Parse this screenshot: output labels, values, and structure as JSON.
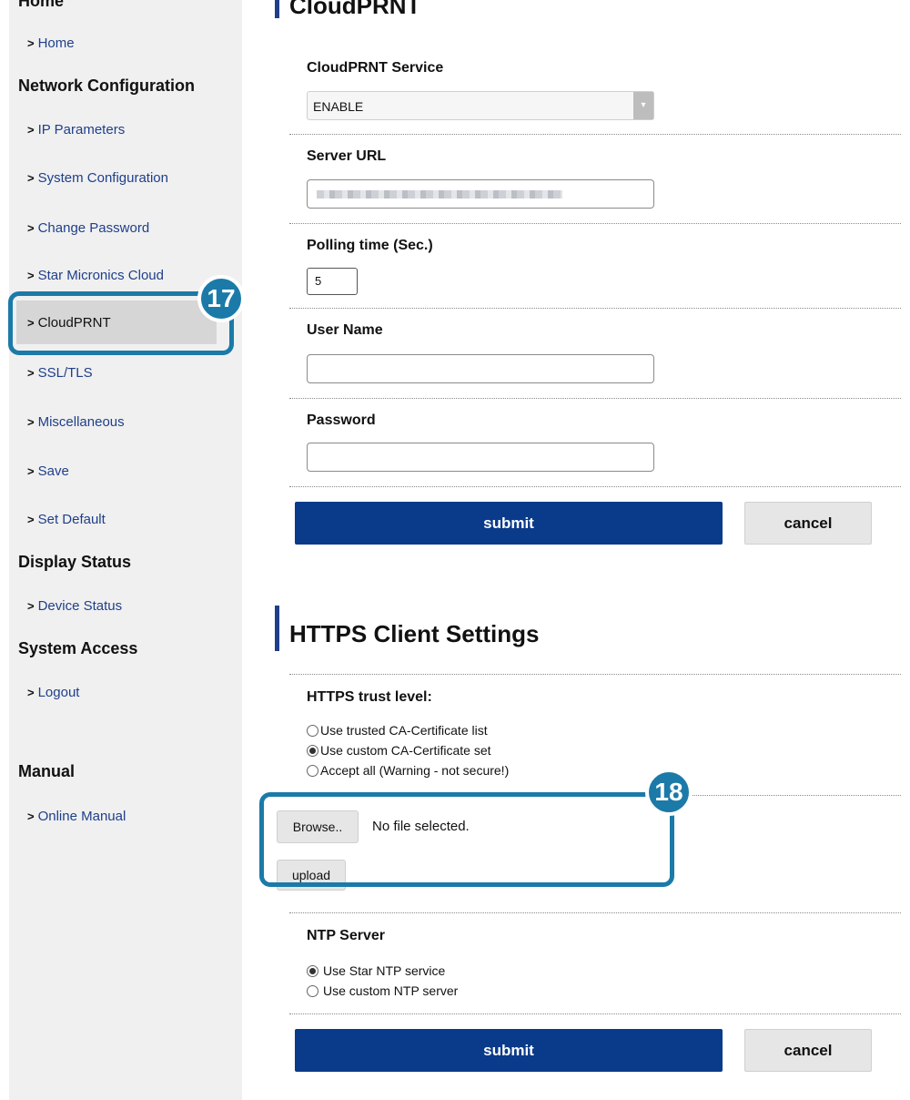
{
  "sidebar": {
    "headings": {
      "home": "Home",
      "network": "Network Configuration",
      "display": "Display Status",
      "access": "System Access",
      "manual": "Manual"
    },
    "items": {
      "home": "Home",
      "ip": "IP Parameters",
      "system": "System Configuration",
      "password": "Change Password",
      "cloud": "Star Micronics Cloud",
      "cloudprnt": "CloudPRNT",
      "ssl": "SSL/TLS",
      "misc": "Miscellaneous",
      "save": "Save",
      "default": "Set Default",
      "device": "Device Status",
      "logout": "Logout",
      "online": "Online Manual"
    },
    "chevron": ">"
  },
  "callouts": {
    "c17": "17",
    "c18": "18"
  },
  "cloudprnt": {
    "title": "CloudPRNT",
    "service_label": "CloudPRNT Service",
    "service_value": "ENABLE",
    "server_url_label": "Server URL",
    "polling_label": "Polling time (Sec.)",
    "polling_value": "5",
    "username_label": "User Name",
    "password_label": "Password",
    "submit": "submit",
    "cancel": "cancel"
  },
  "https": {
    "title": "HTTPS Client Settings",
    "trust_label": "HTTPS trust level:",
    "options": [
      "Use trusted CA-Certificate list",
      "Use custom CA-Certificate set",
      "Accept all (Warning - not secure!)"
    ],
    "selected_option": 1,
    "browse": "Browse..",
    "no_file": "No file selected.",
    "upload": "upload",
    "ntp_label": "NTP Server",
    "ntp_options": [
      "Use Star NTP service",
      "Use custom NTP server"
    ],
    "ntp_selected": 0,
    "submit": "submit",
    "cancel": "cancel"
  },
  "colors": {
    "accent": "#0a3a8a",
    "callout": "#1b7aa8",
    "link": "#1f3f8a"
  }
}
